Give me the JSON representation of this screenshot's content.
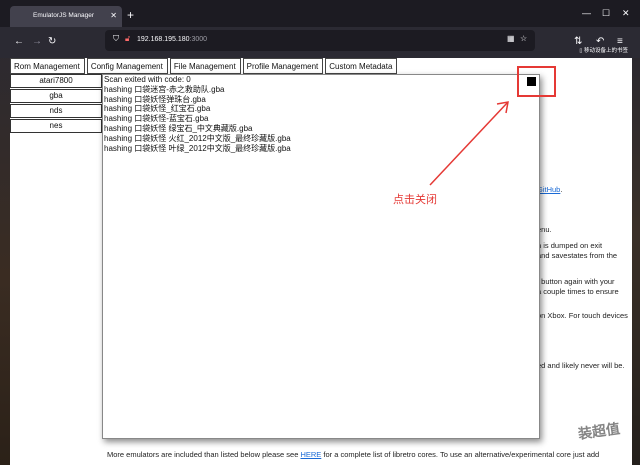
{
  "browser": {
    "tab_title": "EmulatorJS Manager",
    "tab_close": "✕",
    "new_tab": "+",
    "url_host": "192.168.195.180",
    "url_port": ":3000",
    "bookmark_text": "移动设备上的书签",
    "icons": {
      "back": "back-arrow-icon",
      "forward": "forward-arrow-icon",
      "reload": "reload-icon",
      "shield": "shield-icon",
      "lock": "lock-icon",
      "qr": "qr-code-icon",
      "star": "bookmark-star-icon",
      "extensions": "extensions-icon",
      "undo": "undo-icon",
      "menu": "hamburger-menu-icon"
    }
  },
  "nav_tabs": [
    "Rom Management",
    "Config Management",
    "File Management",
    "Profile Management",
    "Custom Metadata"
  ],
  "systems": [
    "atari7800",
    "gba",
    "nds",
    "nes"
  ],
  "background_text": {
    "github_link": "GitHub",
    "github_dot": ".",
    "line_menu": "enu.",
    "line_dumped_1": "n is dumped on exit",
    "line_dumped_2": "and savestates from the",
    "line_button_1": "t button again with your",
    "line_button_2": "a couple times to ensure",
    "line_xbox": "on Xbox. For touch devices",
    "line_never": "ed and likely never will be.",
    "footer_pre": "More emulators are included than listed below please see ",
    "footer_link": "HERE",
    "footer_post": " for a complete list of libretro cores. To use an alternative/experimental core just add"
  },
  "modal": {
    "log_lines": [
      "Scan exited with code: 0",
      "hashing 口袋迷宫-赤之救助队.gba",
      "hashing 口袋妖怪弹珠台.gba",
      "hashing 口袋妖怪_红宝石.gba",
      "hashing 口袋妖怪-蓝宝石.gba",
      "hashing 口袋妖怪 绿宝石_中文典藏版.gba",
      "hashing 口袋妖怪 火红_2012中文版_最终珍藏版.gba",
      "hashing 口袋妖怪 叶绿_2012中文版_最终珍藏版.gba"
    ]
  },
  "annotation": {
    "text": "点击关闭",
    "color": "#e53935"
  },
  "watermark": "装超值"
}
